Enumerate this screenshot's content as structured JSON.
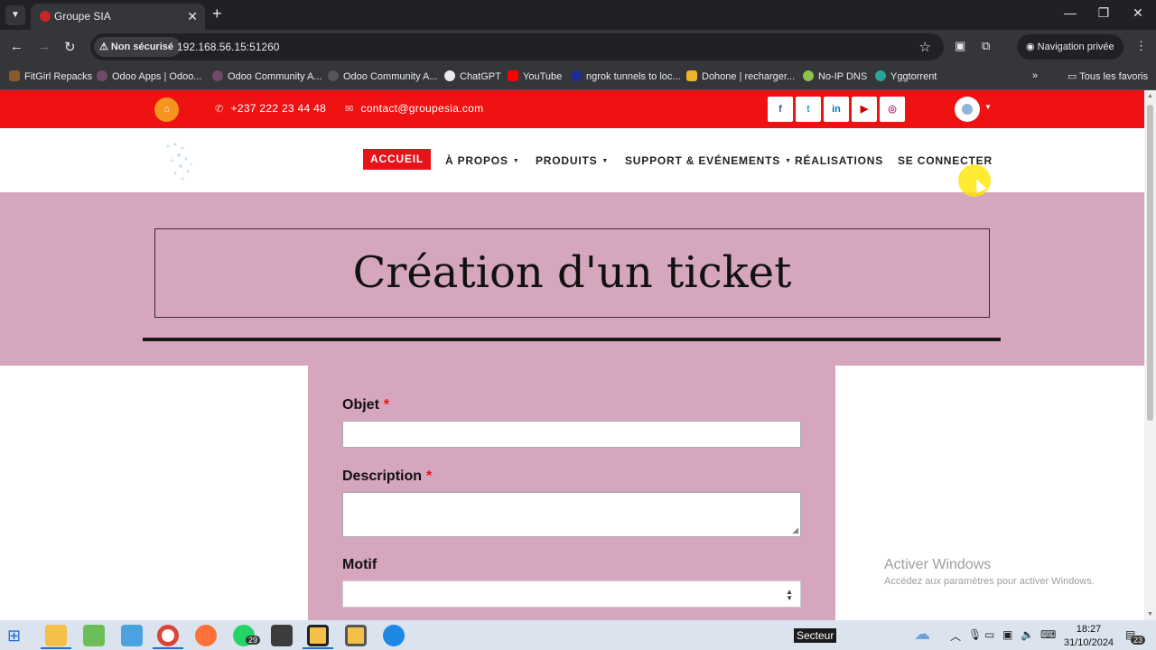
{
  "browser": {
    "tab_title": "Groupe SIA",
    "security_label": "Non sécurisé",
    "url": "192.168.56.15:51260",
    "private_label": "Navigation privée",
    "bookmarks": [
      {
        "label": "FitGirl Repacks",
        "color": "#8b5a2b"
      },
      {
        "label": "Odoo Apps | Odoo...",
        "color": "#714b67"
      },
      {
        "label": "Odoo Community A...",
        "color": "#714b67"
      },
      {
        "label": "Odoo Community A...",
        "color": "#333333"
      },
      {
        "label": "ChatGPT",
        "color": "#e8eaed"
      },
      {
        "label": "YouTube",
        "color": "#ff0000"
      },
      {
        "label": "ngrok tunnels to loc...",
        "color": "#1f2d8f"
      },
      {
        "label": "Dohone | recharger...",
        "color": "#f0b429"
      },
      {
        "label": "No-IP DNS",
        "color": "#8bc34a"
      },
      {
        "label": "Yggtorrent",
        "color": "#26a69a"
      }
    ],
    "all_bookmarks": "Tous les favoris"
  },
  "topbar": {
    "phone": "+237 222 23 44 48",
    "email": "contact@groupesia.com",
    "social": [
      {
        "icon": "f",
        "name": "facebook-icon",
        "color": "#3b5998"
      },
      {
        "icon": "t",
        "name": "twitter-icon",
        "color": "#1da1f2"
      },
      {
        "icon": "in",
        "name": "linkedin-icon",
        "color": "#0077b5"
      },
      {
        "icon": "▶",
        "name": "youtube-icon",
        "color": "#cc0000"
      },
      {
        "icon": "◎",
        "name": "instagram-icon",
        "color": "#c13584"
      }
    ]
  },
  "nav": {
    "home": "ACCUEIL",
    "about": "À PROPOS",
    "products": "PRODUITS",
    "support": "SUPPORT & EVÉNEMENTS",
    "realisations": "RÉALISATIONS",
    "login": "SE CONNECTER"
  },
  "hero": {
    "title": "Création d'un ticket"
  },
  "form": {
    "subject_label": "Objet",
    "description_label": "Description",
    "reason_label": "Motif",
    "required_mark": "*",
    "subject_value": "",
    "description_value": "",
    "reason_value": ""
  },
  "watermark": {
    "line1": "Activer Windows",
    "line2": "Accédez aux paramètres pour activer Windows."
  },
  "taskbar": {
    "whatsapp_badge": "29",
    "secteur": "Secteur",
    "time": "18:27",
    "date": "31/10/2024",
    "notif_badge": "23"
  }
}
